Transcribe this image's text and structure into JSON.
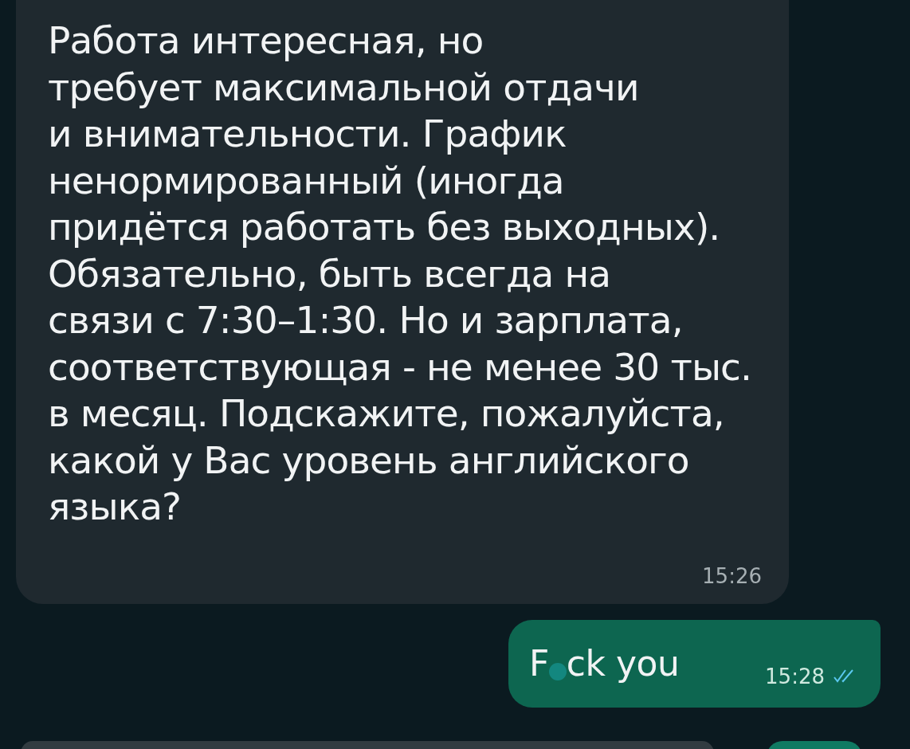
{
  "messages": [
    {
      "kind": "incoming",
      "lines": [
        "Работа интересная, но",
        "требует максимальной отдачи",
        "и внимательности. График",
        "ненормированный (иногда",
        "придётся работать без выходных).",
        "Обязательно, быть всегда на",
        "связи с 7:30–1:30. Но и зарплата,",
        "соответствующая - не менее 30 тыс.",
        "в месяц. Подскажите, пожалуйста,",
        "какой у Вас уровень английского",
        "языка?"
      ],
      "time": "15:26"
    },
    {
      "kind": "outgoing",
      "parts": [
        "F",
        "ck you"
      ],
      "censored": true,
      "time": "15:28",
      "read": true
    }
  ]
}
